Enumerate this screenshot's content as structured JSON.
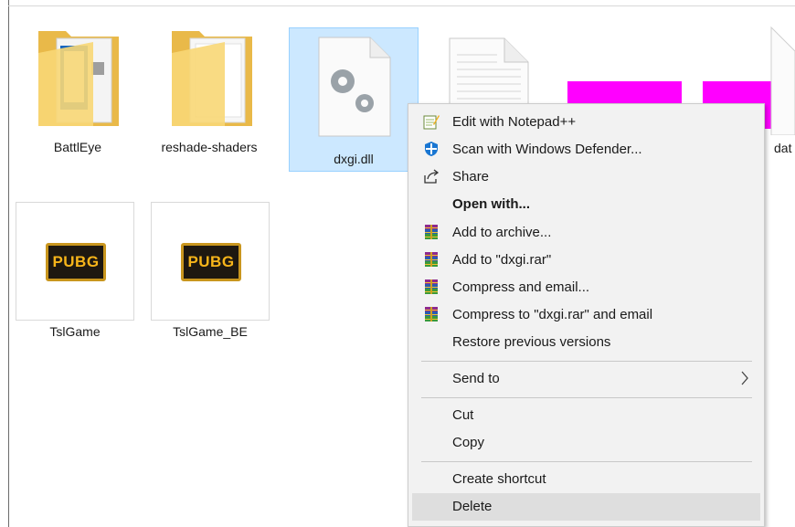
{
  "explorer": {
    "items": [
      {
        "label": "BattlEye",
        "icon": "folder-icon"
      },
      {
        "label": "reshade-shaders",
        "icon": "folder-icon"
      },
      {
        "label": "dxgi.dll",
        "icon": "dll-file-icon",
        "selected": true
      },
      {
        "label": "TslGame",
        "icon": "pubg-icon"
      },
      {
        "label": "TslGame_BE",
        "icon": "pubg-icon"
      }
    ],
    "partial_label": "dat"
  },
  "context_menu": {
    "items": [
      {
        "label": "Edit with Notepad++",
        "icon": "notepadpp-icon"
      },
      {
        "label": "Scan with Windows Defender...",
        "icon": "defender-shield-icon"
      },
      {
        "label": "Share",
        "icon": "share-icon"
      },
      {
        "label": "Open with...",
        "bold": true
      },
      {
        "label": "Add to archive...",
        "icon": "winrar-icon"
      },
      {
        "label": "Add to \"dxgi.rar\"",
        "icon": "winrar-icon"
      },
      {
        "label": "Compress and email...",
        "icon": "winrar-icon"
      },
      {
        "label": "Compress to \"dxgi.rar\" and email",
        "icon": "winrar-icon"
      },
      {
        "label": "Restore previous versions"
      },
      {
        "label": "Send to",
        "submenu": true
      },
      {
        "label": "Cut"
      },
      {
        "label": "Copy"
      },
      {
        "label": "Create shortcut"
      },
      {
        "label": "Delete",
        "highlighted": true
      }
    ]
  },
  "colors": {
    "selection_bg": "#cce8ff",
    "menu_bg": "#f2f2f2",
    "hover_bg": "#dedede",
    "magenta": "#ff00ff",
    "folder_yellow": "#f8d775"
  }
}
